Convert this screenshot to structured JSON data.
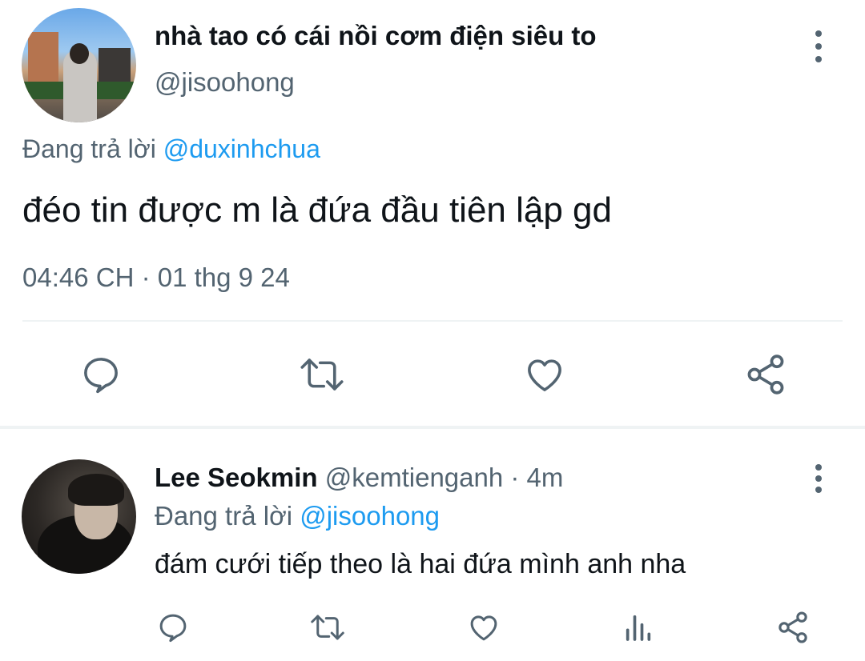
{
  "main_tweet": {
    "display_name": "nhà tao có cái nồi cơm điện siêu to",
    "handle": "@jisoohong",
    "reply_prefix": "Đang trả lời",
    "reply_to": "@duxinhchua",
    "text": "đéo tin được m là đứa đầu tiên lập gd",
    "timestamp": "04:46 CH · 01 thg 9 24",
    "actions": [
      "reply-icon",
      "retweet-icon",
      "like-icon",
      "share-icon"
    ]
  },
  "reply_tweet": {
    "display_name": "Lee Seokmin",
    "handle": "@kemtienganh",
    "separator": " · ",
    "time": "4m",
    "reply_prefix": "Đang trả lời",
    "reply_to": "@jisoohong",
    "text": "đám cưới tiếp theo là hai đứa mình anh nha",
    "actions": [
      "reply-icon",
      "retweet-icon",
      "like-icon",
      "views-icon",
      "share-icon"
    ]
  },
  "colors": {
    "icon": "#536471",
    "mention": "#1d9bf0",
    "text": "#0f1419",
    "divider": "#eff3f4"
  }
}
